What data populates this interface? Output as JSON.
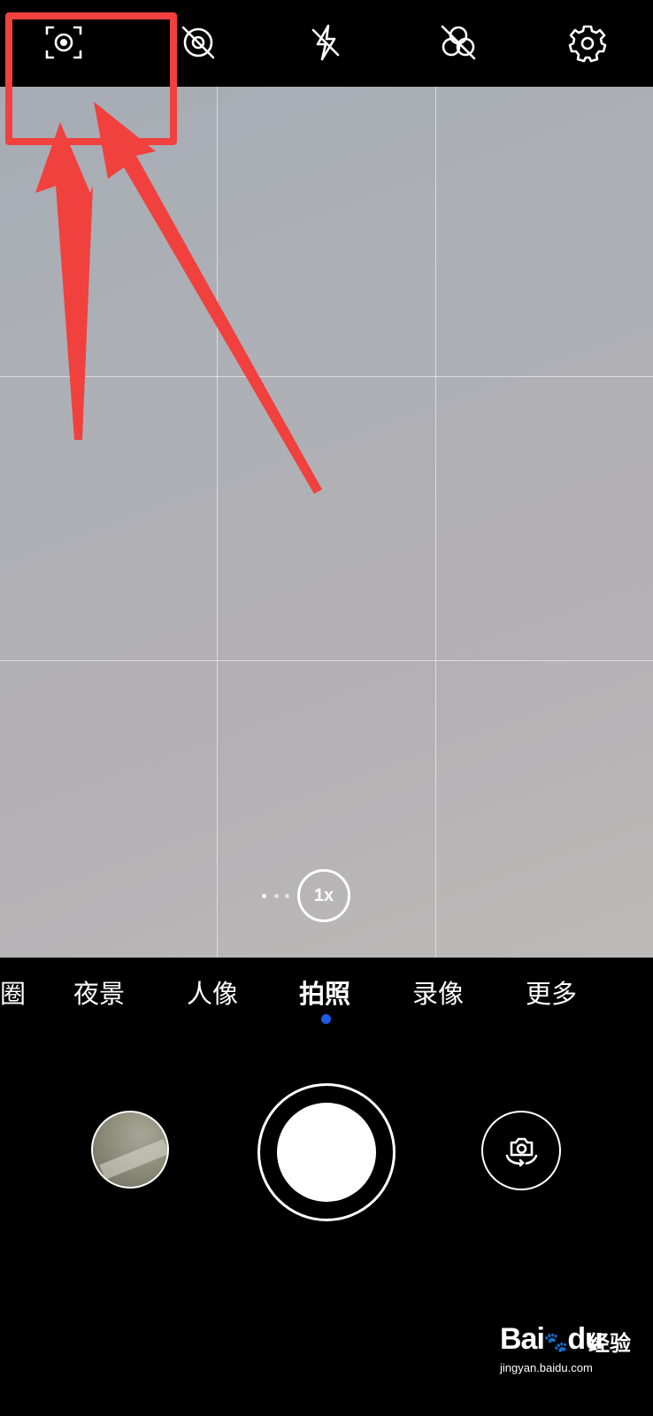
{
  "top_bar": {
    "icons": [
      "ai-lens-icon",
      "motion-photo-off-icon",
      "flash-off-icon",
      "filter-off-icon",
      "settings-icon"
    ]
  },
  "viewfinder": {
    "zoom_label": "1x"
  },
  "modes": {
    "items": [
      "圈",
      "夜景",
      "人像",
      "拍照",
      "录像",
      "更多"
    ],
    "active_index": 3,
    "active_indicator_color": "#1f5ce6"
  },
  "annotation": {
    "color": "#f0413f"
  },
  "watermark": {
    "logo_text": "Bai",
    "logo_text_2": "du",
    "jingyan": "经验",
    "url": "jingyan.baidu.com"
  }
}
